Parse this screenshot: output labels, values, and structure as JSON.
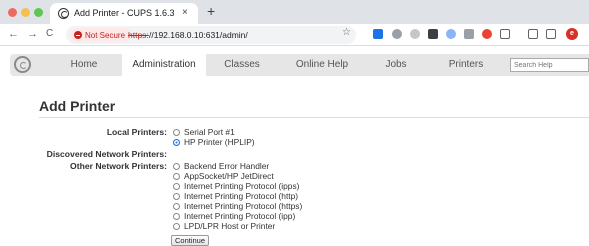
{
  "browser": {
    "tab_title": "Add Printer - CUPS 1.6.3",
    "tab_close": "×",
    "new_tab": "+",
    "nav": {
      "back": "←",
      "forward": "→",
      "reload": "C"
    },
    "security_chip": "Not Secure",
    "url_scheme": "https:",
    "url_rest": "//192.168.0.10:631/admin/",
    "star": "☆",
    "profile_initial": "e"
  },
  "cups_nav": {
    "items": [
      {
        "label": "Home",
        "active": false
      },
      {
        "label": "Administration",
        "active": true
      },
      {
        "label": "Classes",
        "active": false
      },
      {
        "label": "Online Help",
        "active": false
      },
      {
        "label": "Jobs",
        "active": false
      },
      {
        "label": "Printers",
        "active": false
      }
    ],
    "search_placeholder": "Search Help"
  },
  "page": {
    "title": "Add Printer",
    "local_printers_label": "Local Printers:",
    "local_printers": [
      {
        "label": "Serial Port #1",
        "checked": false
      },
      {
        "label": "HP Printer (HPLIP)",
        "checked": true
      }
    ],
    "discovered_label": "Discovered Network Printers:",
    "other_label": "Other Network Printers:",
    "other_printers": [
      {
        "label": "Backend Error Handler",
        "checked": false
      },
      {
        "label": "AppSocket/HP JetDirect",
        "checked": false
      },
      {
        "label": "Internet Printing Protocol (ipps)",
        "checked": false
      },
      {
        "label": "Internet Printing Protocol (http)",
        "checked": false
      },
      {
        "label": "Internet Printing Protocol (https)",
        "checked": false
      },
      {
        "label": "Internet Printing Protocol (ipp)",
        "checked": false
      },
      {
        "label": "LPD/LPR Host or Printer",
        "checked": false
      }
    ],
    "continue_label": "Continue"
  }
}
